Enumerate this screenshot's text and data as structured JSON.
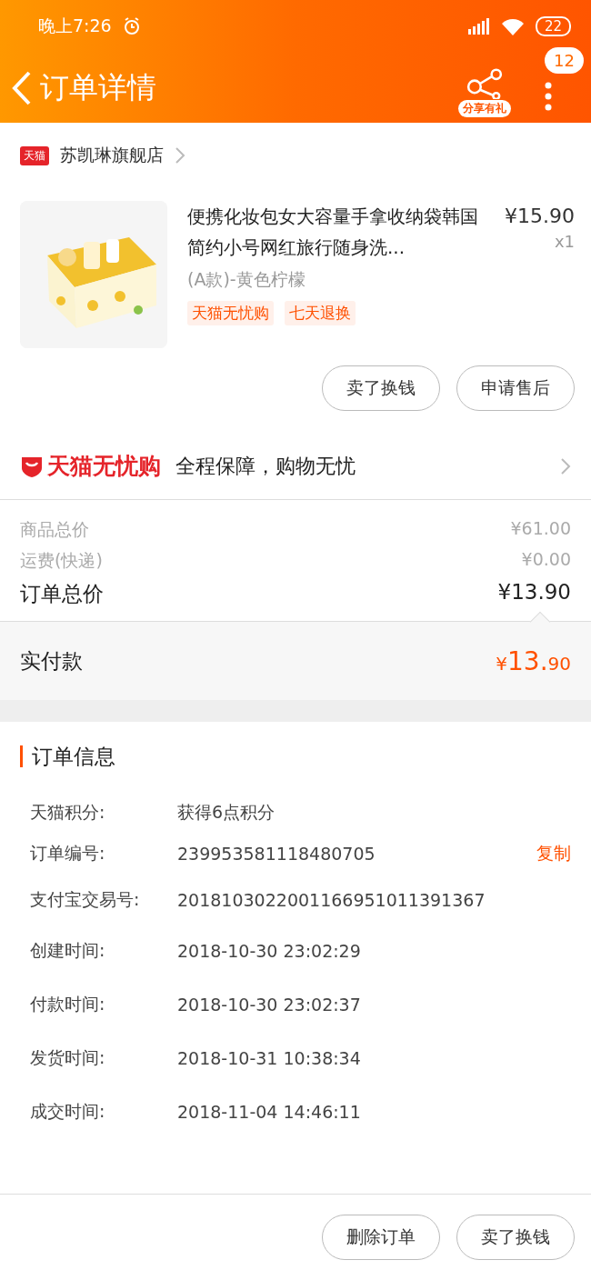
{
  "status_bar": {
    "time": "晚上7:26",
    "battery": "22"
  },
  "header": {
    "title": "订单详情",
    "share_label": "分享有礼",
    "badge": "12"
  },
  "store": {
    "logo": "天猫",
    "name": "苏凯琳旗舰店"
  },
  "product": {
    "title": "便携化妆包女大容量手拿收纳袋韩国简约小号网红旅行随身洗...",
    "price": "¥15.90",
    "qty": "x1",
    "sku": "(A款)-黄色柠檬",
    "tags": [
      "天猫无忧购",
      "七天退换"
    ]
  },
  "item_buttons": [
    "卖了换钱",
    "申请售后"
  ],
  "guarantee": {
    "brand": "天猫无忧购",
    "text": "全程保障，购物无忧"
  },
  "price_rows": [
    {
      "kind": "minor",
      "label": "商品总价",
      "value": "¥61.00"
    },
    {
      "kind": "minor",
      "label": "运费(快递)",
      "value": "¥0.00"
    },
    {
      "kind": "major",
      "label": "订单总价",
      "value": "¥13.90"
    }
  ],
  "paid": {
    "label": "实付款",
    "currency": "¥",
    "integer": "13.",
    "decimal": "90"
  },
  "order_info": {
    "title": "订单信息",
    "rows": [
      {
        "label": "天猫积分:",
        "value": "获得6点积分"
      },
      {
        "label": "订单编号:",
        "value": "239953581118480705",
        "action": "复制"
      },
      {
        "label": "支付宝交易号:",
        "value": "2018103022001166951011391367"
      },
      {
        "label": "创建时间:",
        "value": "2018-10-30 23:02:29"
      },
      {
        "label": "付款时间:",
        "value": "2018-10-30 23:02:37"
      },
      {
        "label": "发货时间:",
        "value": "2018-10-31 10:38:34"
      },
      {
        "label": "成交时间:",
        "value": "2018-11-04 14:46:11"
      }
    ]
  },
  "bottom_buttons": [
    "删除订单",
    "卖了换钱"
  ]
}
